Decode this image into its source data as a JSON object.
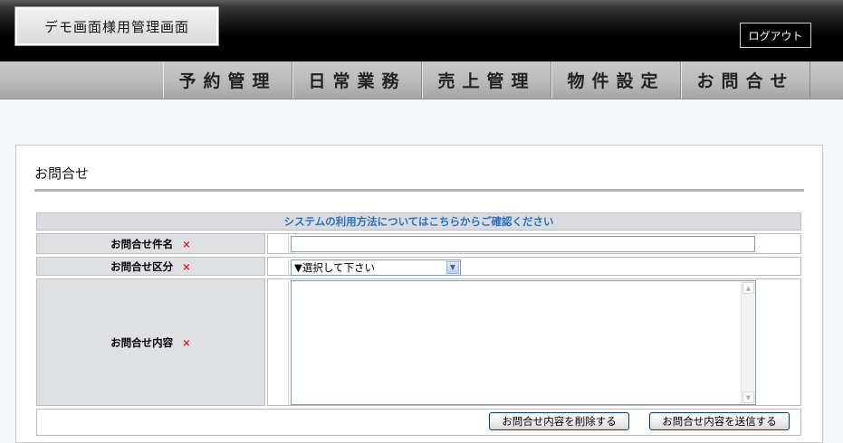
{
  "header": {
    "app_title": "デモ画面様用管理画面",
    "logout_label": "ログアウト"
  },
  "nav": {
    "items": [
      {
        "label": "予約管理"
      },
      {
        "label": "日常業務"
      },
      {
        "label": "売上管理"
      },
      {
        "label": "物件設定"
      },
      {
        "label": "お問合せ"
      }
    ]
  },
  "page": {
    "title": "お問合せ",
    "help_link": "システムの利用方法についてはこちらからご確認ください"
  },
  "form": {
    "required_mark": "×",
    "subject_label": "お問合せ件名",
    "subject_value": "",
    "category_label": "お問合せ区分",
    "category_selected": "▼選択して下さい",
    "content_label": "お問合せ内容",
    "content_value": "",
    "delete_button": "お問合せ内容を削除する",
    "submit_button": "お問合せ内容を送信する"
  }
}
